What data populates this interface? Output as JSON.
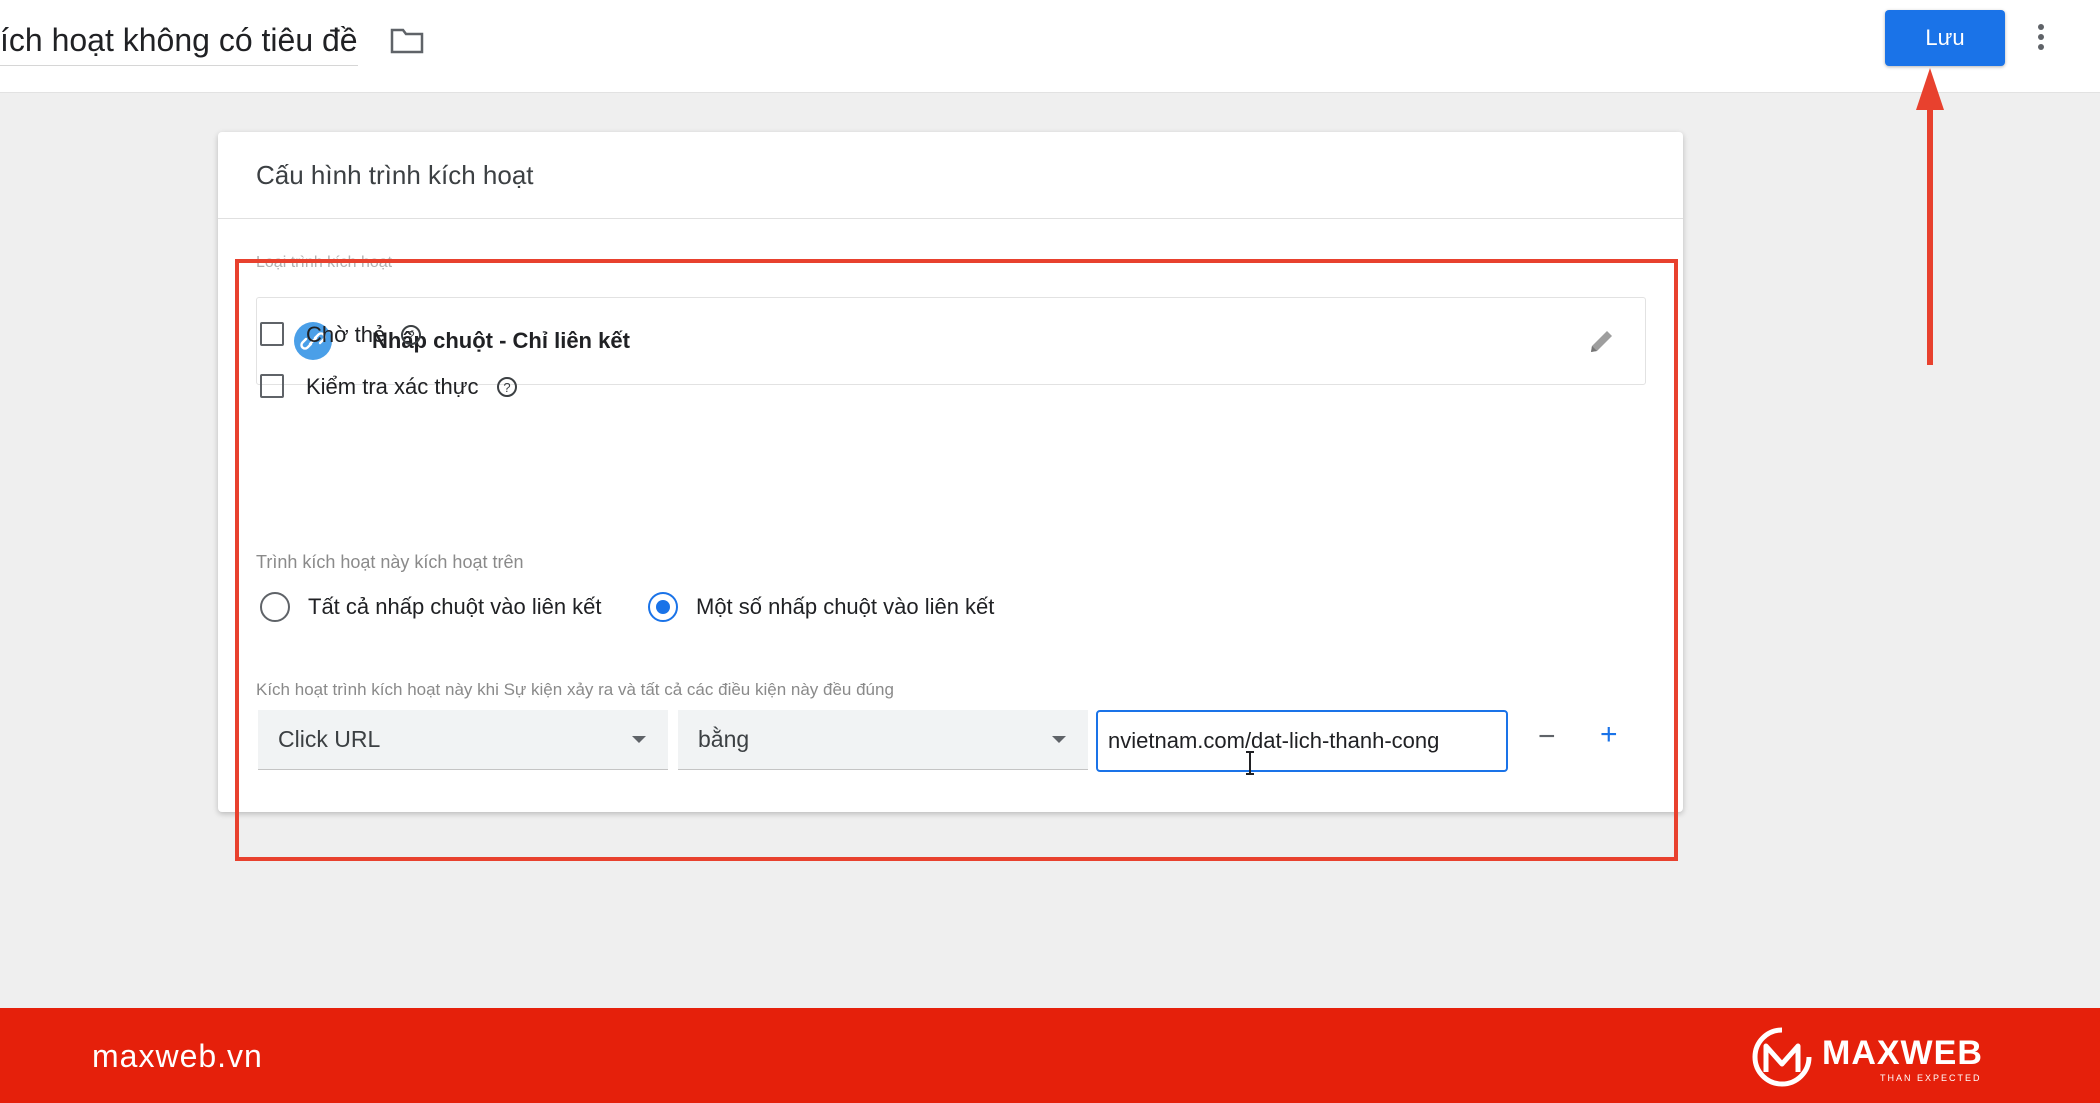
{
  "header": {
    "title": "ích hoạt không có tiêu đề",
    "save_label": "Lưu"
  },
  "card": {
    "title": "Cấu hình trình kích hoạt",
    "trigger_type_label": "Loại trình kích hoạt",
    "trigger_type": "Nhấp chuột - Chỉ liên kết",
    "options": {
      "wait_for_tags": "Chờ thẻ",
      "check_validation": "Kiểm tra xác thực"
    },
    "fires_on_label": "Trình kích hoạt này kích hoạt trên",
    "fires_on": {
      "all": "Tất cả nhấp chuột vào liên kết",
      "some": "Một số nhấp chuột vào liên kết",
      "selected": "some"
    },
    "condition_label": "Kích hoạt trình kích hoạt này khi Sự kiện xảy ra và tất cả các điều kiện này đều đúng",
    "condition": {
      "variable": "Click URL",
      "operator": "bằng",
      "value": "nvietnam.com/dat-lich-thanh-cong",
      "remove_label": "−",
      "add_label": "+"
    }
  },
  "footer": {
    "site": "maxweb.vn",
    "brand": "MAXWEB",
    "tagline": "THAN EXPECTED"
  },
  "colors": {
    "primary": "#1a73e8",
    "annotation_red": "#e8412e",
    "footer_red": "#e5200b"
  }
}
